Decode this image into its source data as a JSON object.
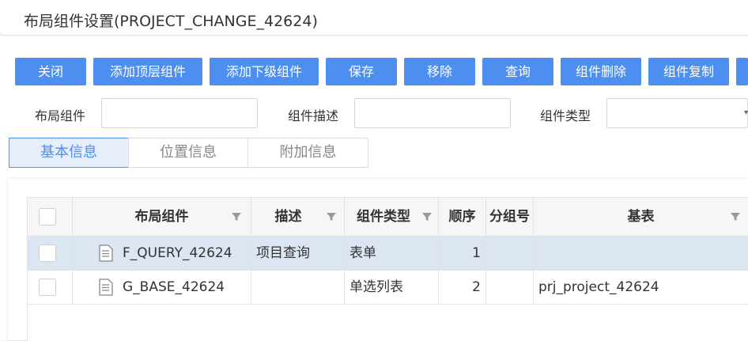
{
  "title": "布局组件设置(PROJECT_CHANGE_42624)",
  "toolbar": {
    "buttons": [
      "关闭",
      "添加顶层组件",
      "添加下级组件",
      "保存",
      "移除",
      "查询",
      "组件删除",
      "组件复制"
    ]
  },
  "filters": {
    "layout_component_label": "布局组件",
    "layout_component_value": "",
    "component_desc_label": "组件描述",
    "component_desc_value": "",
    "component_type_label": "组件类型",
    "component_type_value": ""
  },
  "tabs": [
    {
      "label": "基本信息",
      "active": true
    },
    {
      "label": "位置信息",
      "active": false
    },
    {
      "label": "附加信息",
      "active": false
    }
  ],
  "grid": {
    "columns": [
      "布局组件",
      "描述",
      "组件类型",
      "顺序",
      "分组号",
      "基表"
    ],
    "rows": [
      {
        "component": "F_QUERY_42624",
        "desc": "项目查询",
        "type": "表单",
        "order": "1",
        "group": "",
        "base_table": "",
        "selected": true
      },
      {
        "component": "G_BASE_42624",
        "desc": "",
        "type": "单选列表",
        "order": "2",
        "group": "",
        "base_table": "prj_project_42624",
        "selected": false
      }
    ]
  },
  "colors": {
    "primary": "#4c8ff0",
    "tab_active_bg": "#e6eefb",
    "row_selected_bg": "#dce6f2"
  },
  "icons": {
    "filter": "funnel-icon",
    "row_item": "document-icon",
    "select_arrow": "chevron-down-icon"
  }
}
